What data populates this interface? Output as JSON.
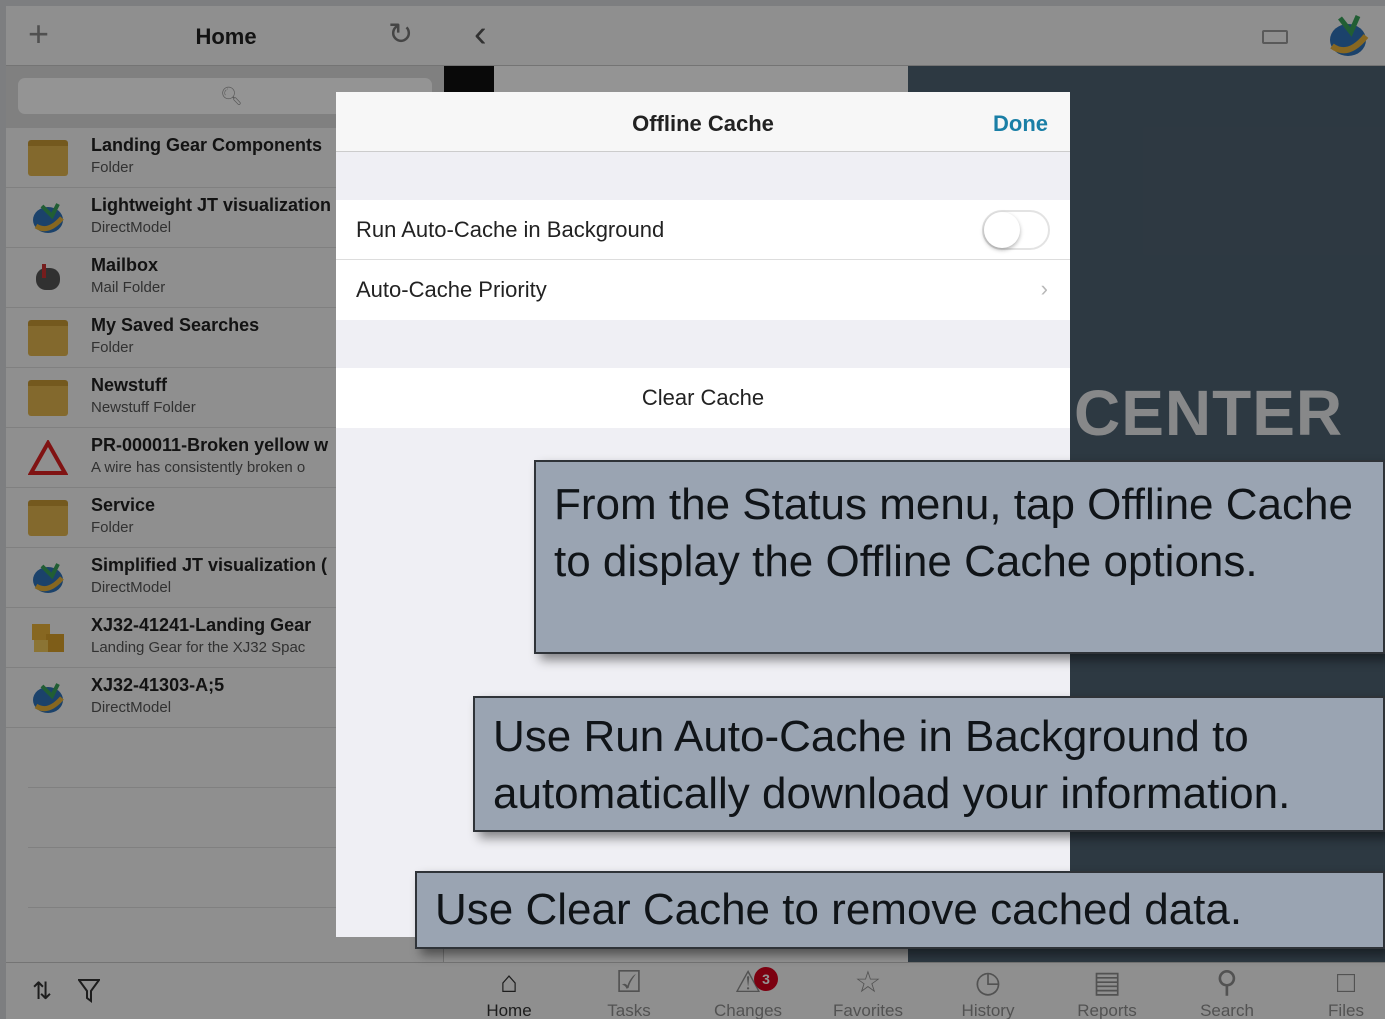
{
  "left_pane": {
    "title": "Home",
    "add_icon": "plus-icon",
    "refresh_icon": "refresh-icon",
    "search_icon": "search-icon",
    "items": [
      {
        "name": "Landing Gear Components",
        "subtitle": "Folder",
        "icon": "folder-icon"
      },
      {
        "name": "Lightweight JT visualization",
        "subtitle": "DirectModel",
        "icon": "directmodel-icon"
      },
      {
        "name": "Mailbox",
        "subtitle": "Mail Folder",
        "icon": "mailbox-icon"
      },
      {
        "name": "My Saved Searches",
        "subtitle": "Folder",
        "icon": "folder-icon"
      },
      {
        "name": "Newstuff",
        "subtitle": "Newstuff Folder",
        "icon": "folder-icon"
      },
      {
        "name": "PR-000011-Broken yellow w",
        "subtitle": "A wire has consistently broken o",
        "icon": "problem-report-icon"
      },
      {
        "name": "Service",
        "subtitle": "Folder",
        "icon": "folder-icon"
      },
      {
        "name": "Simplified JT visualization (",
        "subtitle": "DirectModel",
        "icon": "directmodel-icon"
      },
      {
        "name": "XJ32-41241-Landing Gear",
        "subtitle": "Landing Gear for the XJ32 Spac",
        "icon": "item-revision-icon"
      },
      {
        "name": "XJ32-41303-A;5",
        "subtitle": "DirectModel",
        "icon": "directmodel-icon"
      }
    ],
    "sort_icon": "sort-icon",
    "filter_icon": "filter-icon"
  },
  "right_pane": {
    "back_icon": "back-chevron-icon",
    "status_icon": "status-icon",
    "logo_icon": "teamcenter-logo-icon",
    "brand_text": "CENTER",
    "tabs": [
      {
        "label": "Home",
        "icon": "home-icon",
        "active": true
      },
      {
        "label": "Tasks",
        "icon": "tasks-icon"
      },
      {
        "label": "Changes",
        "icon": "changes-icon",
        "badge": "3"
      },
      {
        "label": "Favorites",
        "icon": "star-icon"
      },
      {
        "label": "History",
        "icon": "history-icon"
      },
      {
        "label": "Reports",
        "icon": "reports-icon"
      },
      {
        "label": "Search",
        "icon": "search-icon"
      },
      {
        "label": "Files",
        "icon": "files-icon"
      }
    ]
  },
  "modal": {
    "title": "Offline Cache",
    "done_label": "Done",
    "run_background_label": "Run Auto-Cache in Background",
    "run_background_enabled": false,
    "priority_label": "Auto-Cache Priority",
    "clear_label": "Clear Cache"
  },
  "callouts": {
    "c1": "From the Status menu, tap Offline Cache to display the Offline Cache options.",
    "c2": "Use Run Auto-Cache in Background to automatically download your information.",
    "c3": "Use Clear Cache to remove cached data."
  },
  "colors": {
    "accent": "#1a7fa6",
    "brand_panel": "#4f6372",
    "callout": "#9aa4b2",
    "badge": "#d6001c"
  }
}
